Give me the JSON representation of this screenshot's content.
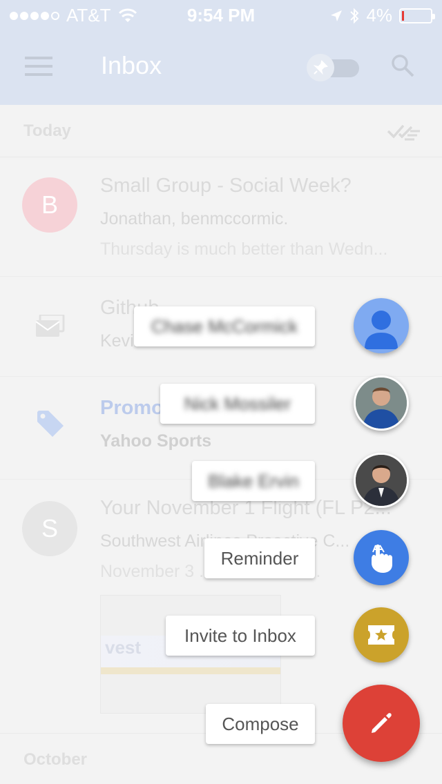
{
  "status_bar": {
    "carrier": "AT&T",
    "time": "9:54 PM",
    "battery": "4%"
  },
  "app_bar": {
    "title": "Inbox"
  },
  "list": {
    "today_label": "Today",
    "rows": [
      {
        "avatar_letter": "B",
        "subject": "Small Group - Social Week?",
        "senders": "Jonathan, benmccormic.",
        "snippet": "Thursday is much better than Wedn..."
      },
      {
        "subject": "Github",
        "senders": "Kevin Durant"
      },
      {
        "subject": "Promos",
        "senders": "Yahoo Sports"
      },
      {
        "avatar_letter": "S",
        "subject": "Your November 1 Flight (FL P2...",
        "senders": "Southwest Airlines Proactive C...",
        "snippet": "November 3 ... SOUTHWE..."
      }
    ],
    "october_label": "October"
  },
  "speed_dial": {
    "contact_1": "Chase McCormick",
    "contact_2": "Nick Mossiler",
    "contact_3": "Blake Ervin",
    "reminder": "Reminder",
    "invite": "Invite to Inbox",
    "compose": "Compose"
  },
  "colors": {
    "compose_fab": "#dd4137",
    "reminder_fab": "#3e7de4",
    "invite_fab": "#cba22b",
    "contact_fab": "#7faaf1"
  }
}
